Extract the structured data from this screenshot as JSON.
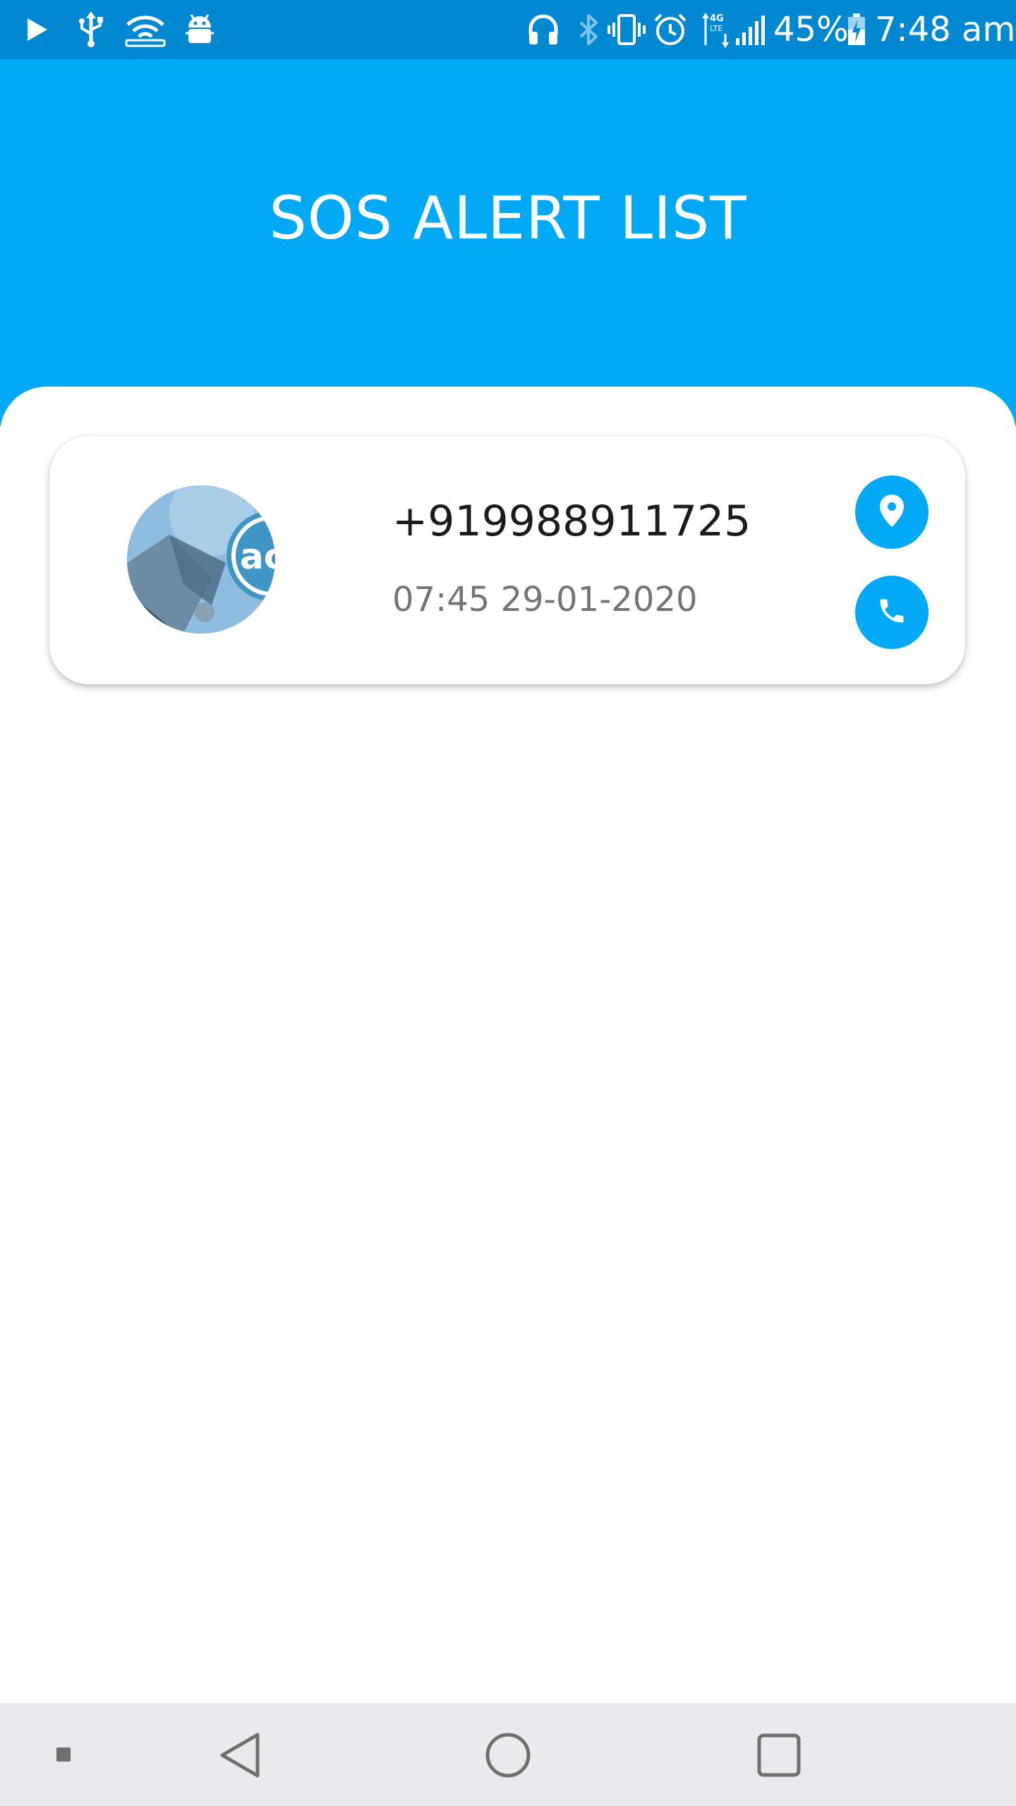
{
  "status_bar": {
    "left_icons": [
      "play-icon",
      "usb-icon",
      "wifi-hotspot-icon",
      "android-debug-icon"
    ],
    "right_icons": [
      "headset-icon",
      "bluetooth-icon",
      "vibrate-icon",
      "alarm-icon",
      "4g-lte-icon",
      "signal-icon",
      "battery-icon"
    ],
    "battery_text": "45%",
    "time": "7:48 am",
    "background_color": "#0288d1"
  },
  "header": {
    "title": "SOS ALERT LIST",
    "background_color": "#03a9f4"
  },
  "alerts": [
    {
      "avatar_text": "acr",
      "phone": "+919988911725",
      "time": "07:45 29-01-2020",
      "actions": [
        "location-icon",
        "phone-icon"
      ]
    }
  ],
  "nav_bar": {
    "icons": [
      "square-small-icon",
      "back-icon",
      "home-icon",
      "recents-icon"
    ],
    "background_color": "#e9eaed"
  },
  "colors": {
    "accent": "#03a9f4",
    "primary_text": "#1c1c1c",
    "secondary_text": "#757575"
  }
}
